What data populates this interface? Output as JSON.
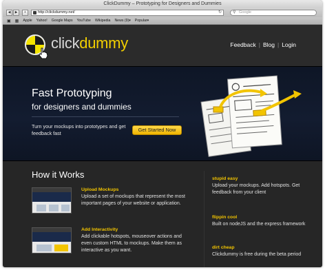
{
  "browser": {
    "window_title": "ClickDummy – Prototyping for Designers and Dummies",
    "url": "http://clickdummy.net/",
    "search_placeholder": "Google",
    "bookmarks": [
      "Apple",
      "Yahoo!",
      "Google Maps",
      "YouTube",
      "Wikipedia",
      "News (9)▾",
      "Popular▾"
    ]
  },
  "header": {
    "logo_prefix": "click",
    "logo_suffix": "dummy",
    "nav": [
      "Feedback",
      "Blog",
      "Login"
    ]
  },
  "hero": {
    "title": "Fast Prototyping",
    "subtitle": "for designers and dummies",
    "text": "Turn your mockups into prototypes and get feedback fast",
    "cta_label": "Get Started Now"
  },
  "how_it_works": {
    "title": "How it Works",
    "steps": [
      {
        "title": "Upload Mockups",
        "body": "Upload a set of mockups that represent the most important pages of your website or application."
      },
      {
        "title": "Add Interactivity",
        "body": "Add clickable hotspots, mouseover actions and even custom HTML to mockups. Make them as interactive as you want."
      }
    ]
  },
  "features": [
    {
      "title": "stupid easy",
      "body": "Upload your mockups. Add hotspots. Get feedback from your client"
    },
    {
      "title": "flippin cool",
      "body": "Built on nodeJS and the express framework"
    },
    {
      "title": "dirt cheap",
      "body": "Clickdummy is free during the beta period"
    }
  ],
  "colors": {
    "accent": "#f2c400",
    "page_bg": "#262626",
    "hero_bg": "#131c30"
  }
}
